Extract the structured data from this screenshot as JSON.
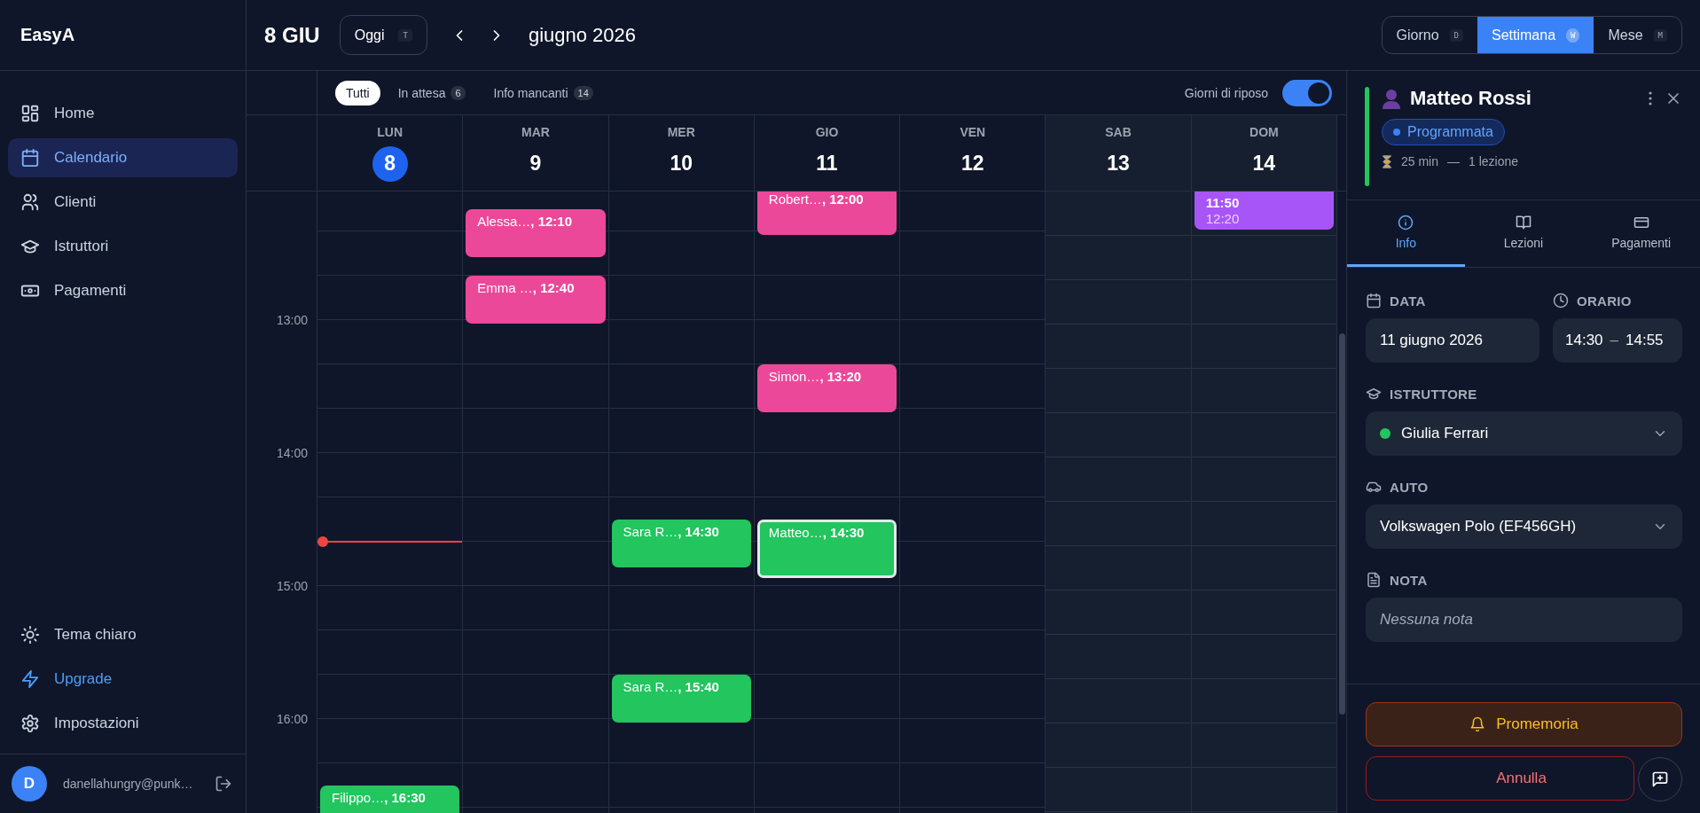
{
  "sidebar": {
    "brand": "EasyA",
    "nav": [
      {
        "label": "Home",
        "selected": false
      },
      {
        "label": "Calendario",
        "selected": true
      },
      {
        "label": "Clienti",
        "selected": false
      },
      {
        "label": "Istruttori",
        "selected": false
      },
      {
        "label": "Pagamenti",
        "selected": false
      }
    ],
    "bottom": [
      {
        "label": "Tema chiaro",
        "kind": "theme"
      },
      {
        "label": "Upgrade",
        "kind": "upgrade"
      },
      {
        "label": "Impostazioni",
        "kind": "settings"
      }
    ],
    "user": {
      "initial": "D",
      "email": "danellahungry@punk…"
    }
  },
  "toolbar": {
    "date_label": "8 GIU",
    "today_button": {
      "label": "Oggi",
      "shortcut": "T"
    },
    "month_label": "giugno 2026",
    "views": [
      {
        "label": "Giorno",
        "shortcut": "D",
        "selected": false
      },
      {
        "label": "Settimana",
        "shortcut": "W",
        "selected": true
      },
      {
        "label": "Mese",
        "shortcut": "M",
        "selected": false
      }
    ]
  },
  "filters": [
    {
      "label": "Tutti",
      "selected": true
    },
    {
      "label": "In attesa",
      "count": "6",
      "selected": false
    },
    {
      "label": "Info mancanti",
      "count": "14",
      "selected": false
    }
  ],
  "rest_days": {
    "label": "Giorni di riposo",
    "on": true
  },
  "hours": [
    "13:00",
    "14:00",
    "15:00",
    "16:00"
  ],
  "days": [
    {
      "name": "LUN",
      "number": "8",
      "today": true,
      "rest": false,
      "events": [
        {
          "kind": "lesson",
          "name": "Filippo…",
          "time": ", 16:30",
          "color": "#22c55e",
          "selected": false
        }
      ]
    },
    {
      "name": "MAR",
      "number": "9",
      "today": false,
      "rest": false,
      "events": [
        {
          "kind": "lesson",
          "name": "Alessa…",
          "time": ", 12:10",
          "color": "#ec4899",
          "selected": false
        },
        {
          "kind": "lesson",
          "name": "Emma …",
          "time": ", 12:40",
          "color": "#ec4899",
          "selected": false
        }
      ]
    },
    {
      "name": "MER",
      "number": "10",
      "today": false,
      "rest": false,
      "events": [
        {
          "kind": "lesson",
          "name": "Sara R…",
          "time": ", 14:30",
          "color": "#22c55e",
          "selected": false
        },
        {
          "kind": "lesson",
          "name": "Sara R…",
          "time": ", 15:40",
          "color": "#22c55e",
          "selected": false
        }
      ]
    },
    {
      "name": "GIO",
      "number": "11",
      "today": false,
      "rest": false,
      "events": [
        {
          "kind": "lesson",
          "name": "Robert…",
          "time": ", 12:00",
          "color": "#ec4899",
          "selected": false
        },
        {
          "kind": "lesson",
          "name": "Simon…",
          "time": ", 13:20",
          "color": "#ec4899",
          "selected": false
        },
        {
          "kind": "lesson",
          "name": "Matteo…",
          "time": ", 14:30",
          "color": "#22c55e",
          "selected": true
        }
      ]
    },
    {
      "name": "VEN",
      "number": "12",
      "today": false,
      "rest": false
    },
    {
      "name": "SAB",
      "number": "13",
      "today": false,
      "rest": true
    },
    {
      "name": "DOM",
      "number": "14",
      "today": false,
      "rest": true,
      "events": [
        {
          "kind": "block",
          "start": "11:50",
          "end": "12:20",
          "color": "#a855f7",
          "selected": false
        }
      ]
    }
  ],
  "detail": {
    "title": "Matteo Rossi",
    "status": "Programmata",
    "duration": "25 min",
    "separator": "—",
    "lessons": "1 lezione",
    "tabs": [
      {
        "label": "Info",
        "selected": true
      },
      {
        "label": "Lezioni",
        "selected": false
      },
      {
        "label": "Pagamenti",
        "selected": false
      }
    ],
    "date": {
      "label": "DATA",
      "value": "11 giugno 2026"
    },
    "time": {
      "label": "ORARIO",
      "start": "14:30",
      "separator": "–",
      "end": "14:55"
    },
    "instructor": {
      "label": "ISTRUTTORE",
      "value": "Giulia Ferrari",
      "color": "#22c55e"
    },
    "car": {
      "label": "AUTO",
      "value": "Volkswagen Polo (EF456GH)"
    },
    "note": {
      "label": "NOTA",
      "placeholder": "Nessuna nota"
    },
    "actions": [
      {
        "label": "Promemoria",
        "kind": "reminder"
      },
      {
        "label": "Annulla",
        "kind": "cancel"
      }
    ]
  }
}
